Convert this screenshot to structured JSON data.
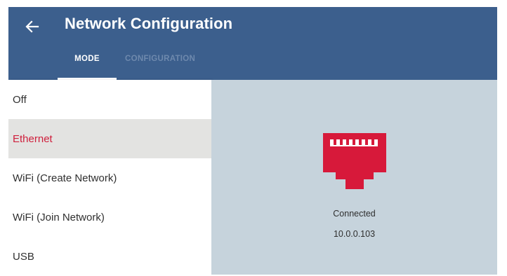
{
  "header": {
    "title": "Network Configuration",
    "back_icon": "arrow-left-icon",
    "background_color": "#3c5f8d"
  },
  "tabs": [
    {
      "label": "MODE",
      "active": true
    },
    {
      "label": "CONFIGURATION",
      "active": false
    }
  ],
  "menu": {
    "items": [
      {
        "label": "Off",
        "selected": false
      },
      {
        "label": "Ethernet",
        "selected": true
      },
      {
        "label": "WiFi (Create Network)",
        "selected": false
      },
      {
        "label": "WiFi (Join Network)",
        "selected": false
      },
      {
        "label": "USB",
        "selected": false
      }
    ],
    "selected_color": "#cf1f3c"
  },
  "status": {
    "icon": "ethernet-port-icon",
    "icon_color": "#d7193a",
    "line1": "Connected",
    "line2": "10.0.0.103"
  }
}
